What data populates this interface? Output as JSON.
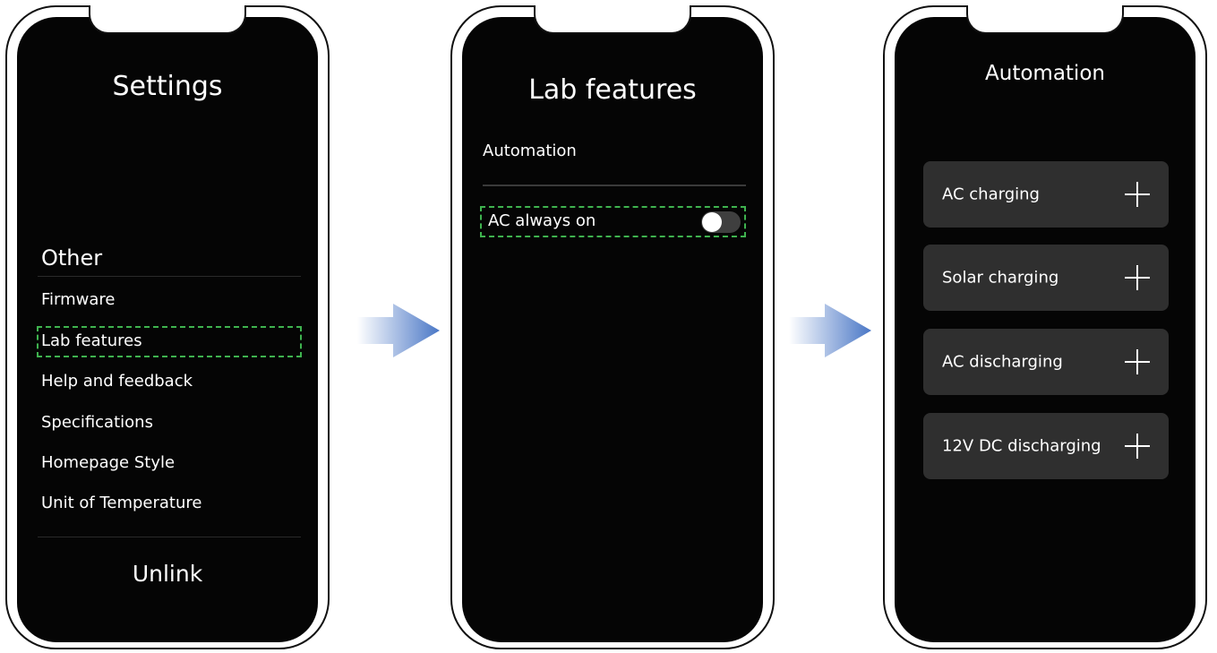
{
  "screens": {
    "settings": {
      "title": "Settings",
      "section_header": "Other",
      "items": [
        {
          "label": "Firmware"
        },
        {
          "label": "Lab features",
          "highlighted": true
        },
        {
          "label": "Help and feedback"
        },
        {
          "label": "Specifications"
        },
        {
          "label": "Homepage Style"
        },
        {
          "label": "Unit of Temperature"
        }
      ],
      "unlink_label": "Unlink"
    },
    "lab_features": {
      "title": "Lab features",
      "section_label": "Automation",
      "toggle_item": {
        "label": "AC always on",
        "enabled": false
      }
    },
    "automation": {
      "title": "Automation",
      "cards": [
        {
          "label": "AC charging"
        },
        {
          "label": "Solar charging"
        },
        {
          "label": "AC discharging"
        },
        {
          "label": "12V DC discharging"
        }
      ]
    }
  },
  "colors": {
    "screen_bg": "#050505",
    "highlight_dash": "#3fb34f",
    "card_bg": "#2f2f2f",
    "arrow_start": "#ffffff",
    "arrow_end": "#4a77c6"
  }
}
